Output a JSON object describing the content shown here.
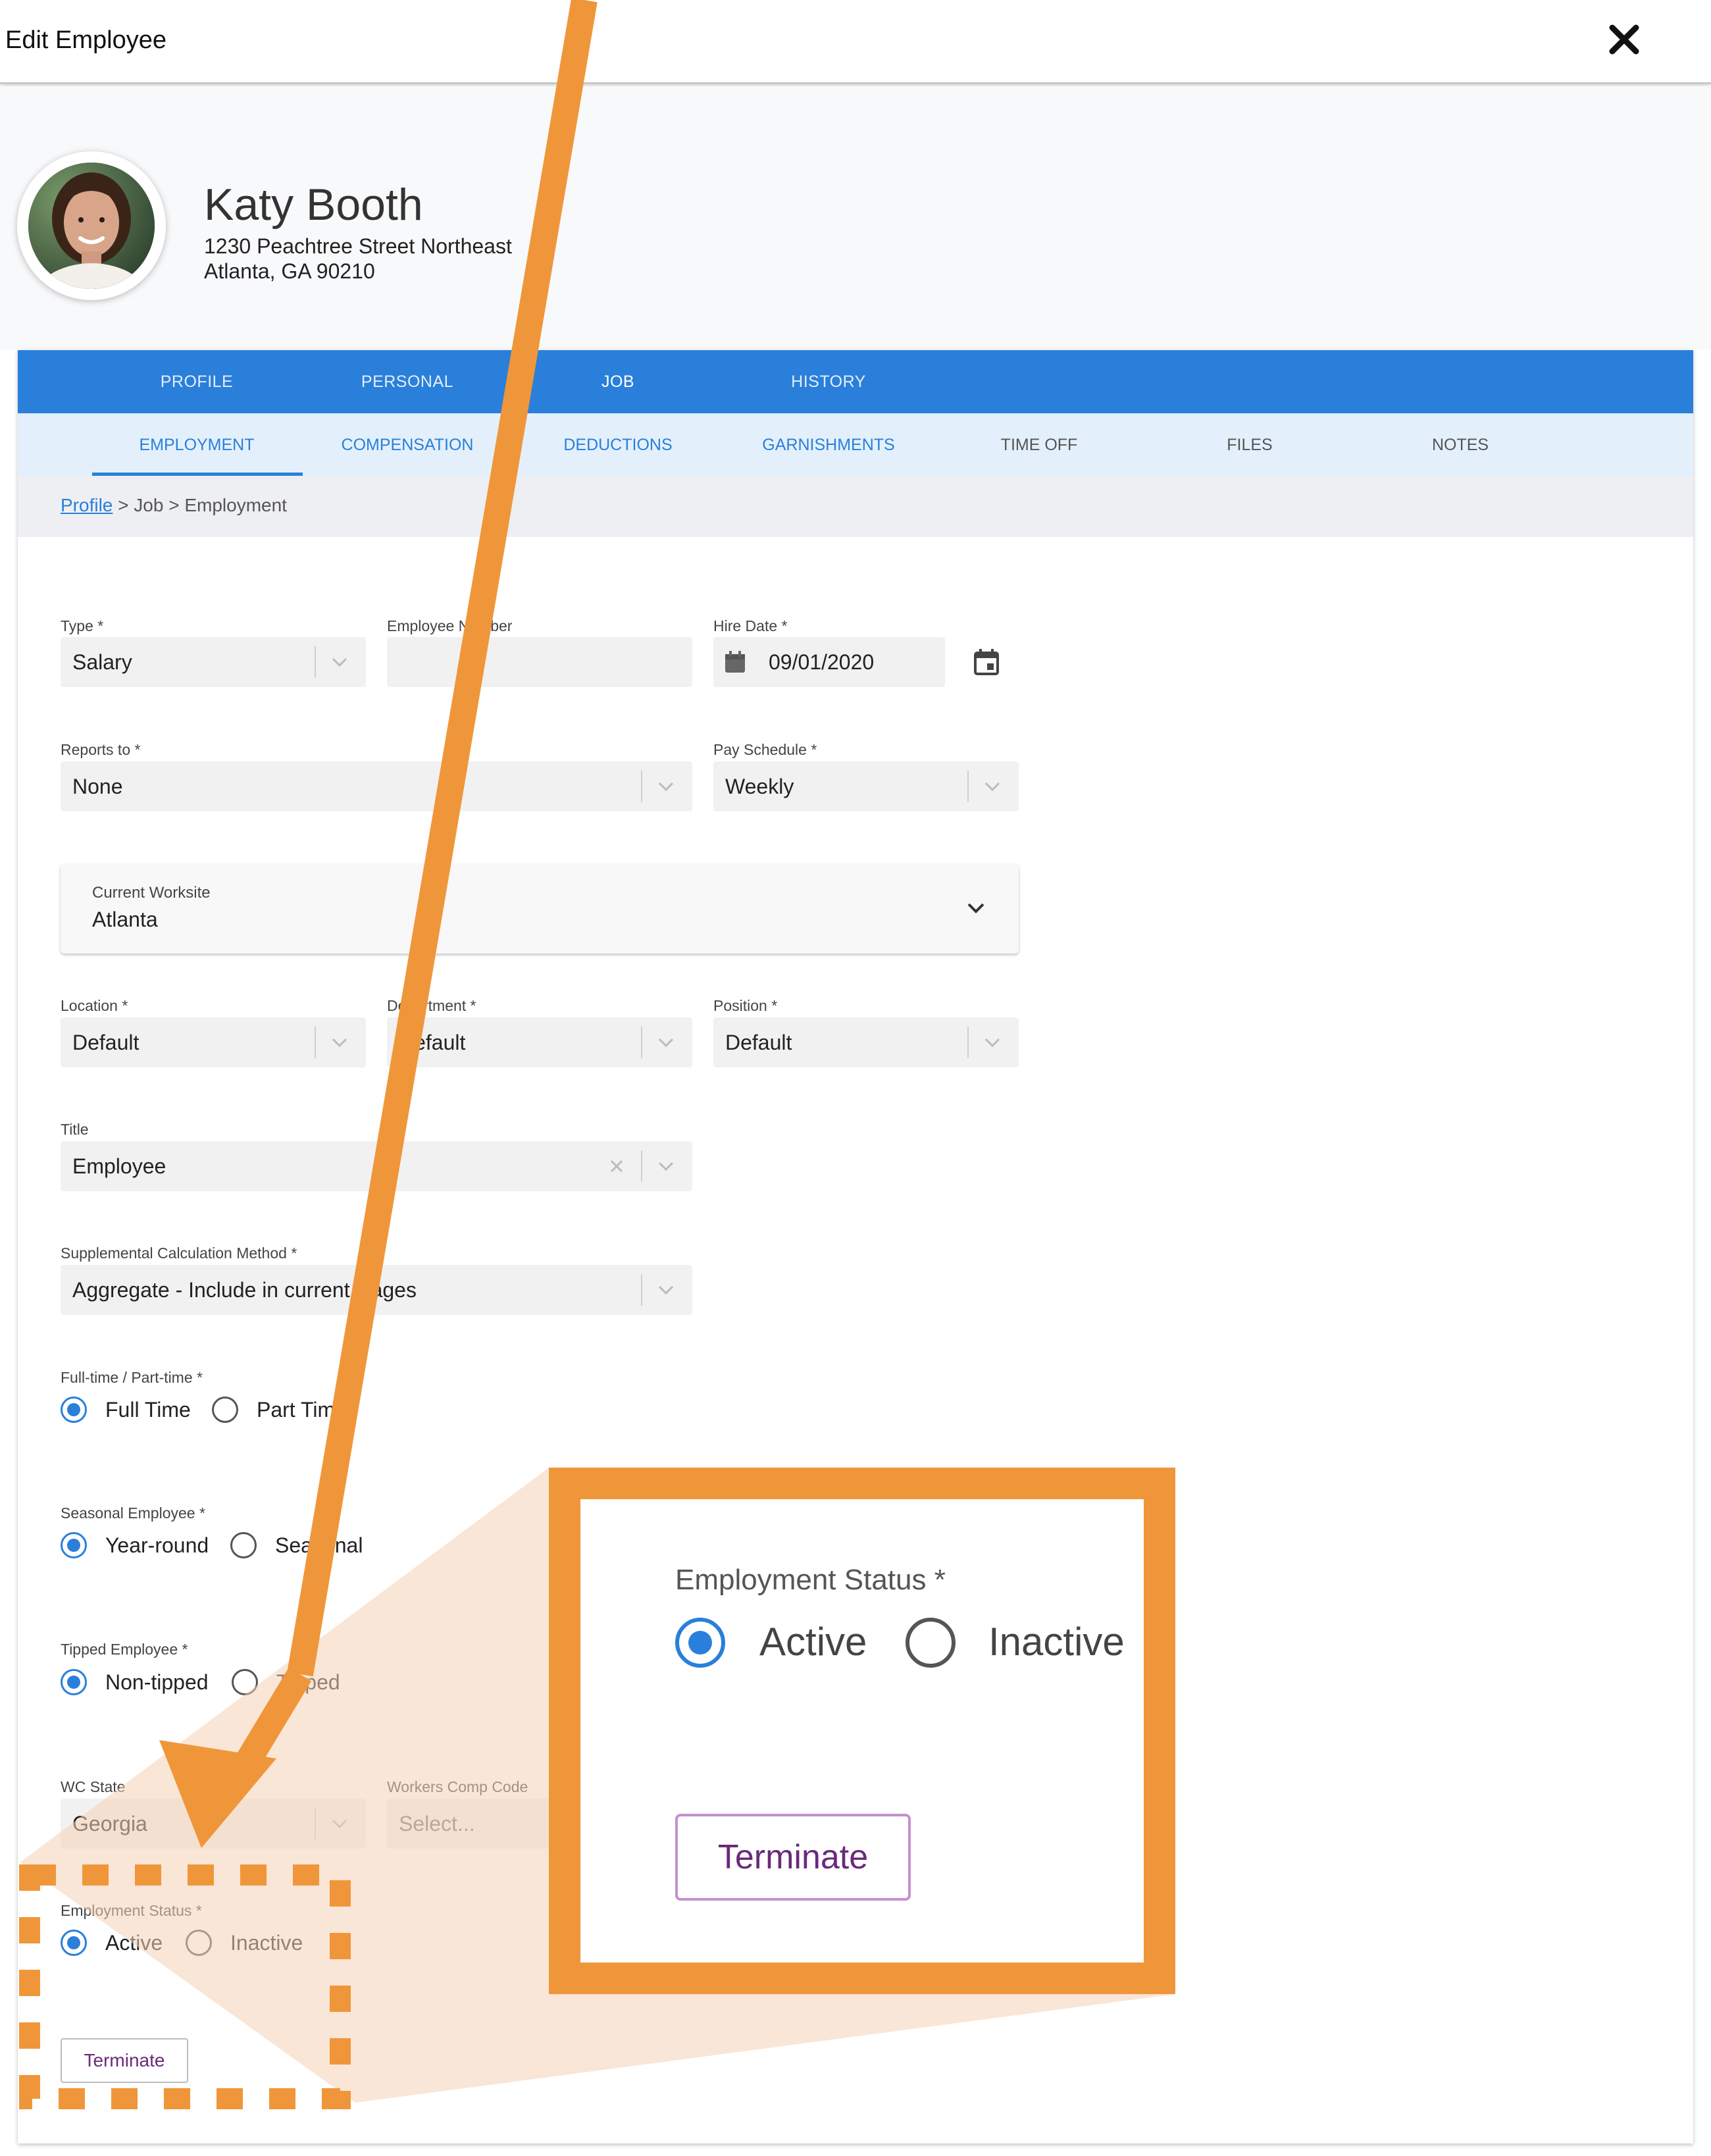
{
  "modal": {
    "title": "Edit Employee"
  },
  "employee": {
    "name": "Katy Booth",
    "address_line1": "1230 Peachtree Street Northeast",
    "address_line2": "Atlanta, GA 90210"
  },
  "main_tabs": [
    {
      "label": "PROFILE",
      "active": false
    },
    {
      "label": "PERSONAL",
      "active": false
    },
    {
      "label": "JOB",
      "active": true
    },
    {
      "label": "HISTORY",
      "active": false
    }
  ],
  "sub_tabs": [
    {
      "label": "EMPLOYMENT",
      "active": true
    },
    {
      "label": "COMPENSATION",
      "active": false
    },
    {
      "label": "DEDUCTIONS",
      "active": false
    },
    {
      "label": "GARNISHMENTS",
      "active": false
    },
    {
      "label": "TIME OFF",
      "active": false
    },
    {
      "label": "FILES",
      "active": false
    },
    {
      "label": "NOTES",
      "active": false
    }
  ],
  "breadcrumb": {
    "link": "Profile",
    "rest": " > Job > Employment"
  },
  "form": {
    "type": {
      "label": "Type *",
      "value": "Salary"
    },
    "employee_number": {
      "label": "Employee Number",
      "value": ""
    },
    "hire_date": {
      "label": "Hire Date *",
      "value": "09/01/2020"
    },
    "reports_to": {
      "label": "Reports to *",
      "value": "None"
    },
    "pay_schedule": {
      "label": "Pay Schedule *",
      "value": "Weekly"
    },
    "current_worksite": {
      "label": "Current Worksite",
      "value": "Atlanta"
    },
    "location": {
      "label": "Location *",
      "value": "Default"
    },
    "department": {
      "label": "Department *",
      "value": "Default"
    },
    "position": {
      "label": "Position *",
      "value": "Default"
    },
    "title": {
      "label": "Title",
      "value": "Employee"
    },
    "supplemental_method": {
      "label": "Supplemental Calculation Method *",
      "value": "Aggregate - Include in current wages"
    },
    "full_part_time": {
      "label": "Full-time / Part-time *",
      "options": [
        "Full Time",
        "Part Time"
      ],
      "selected": "Full Time"
    },
    "seasonal": {
      "label": "Seasonal Employee *",
      "options": [
        "Year-round",
        "Seasonal"
      ],
      "selected": "Year-round"
    },
    "tipped": {
      "label": "Tipped Employee *",
      "options": [
        "Non-tipped",
        "Tipped"
      ],
      "selected": "Non-tipped"
    },
    "wc_state": {
      "label": "WC State",
      "value": "Georgia"
    },
    "workers_comp_code": {
      "label": "Workers Comp Code",
      "placeholder": "Select..."
    },
    "employment_status": {
      "label": "Employment Status *",
      "options": [
        "Active",
        "Inactive"
      ],
      "selected": "Active"
    },
    "terminate_label": "Terminate"
  },
  "zoom_callout": {
    "label": "Employment Status *",
    "options": [
      "Active",
      "Inactive"
    ],
    "selected": "Active",
    "button_label": "Terminate"
  },
  "colors": {
    "primary_blue": "#2a7fda",
    "subtab_bg": "#e3f0fc",
    "callout_orange": "#f0963a",
    "callout_fill": "#f9e4d3",
    "terminate_text": "#6a2a7a"
  }
}
